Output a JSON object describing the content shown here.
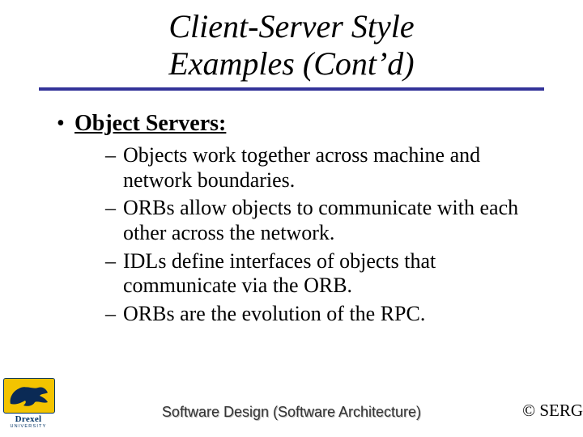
{
  "title": {
    "line1": "Client-Server Style",
    "line2": "Examples (Cont’d)"
  },
  "bullet": {
    "marker": "•",
    "text": "Object Servers:"
  },
  "sub": {
    "dash": "–",
    "items": [
      "Objects work together across machine and network boundaries.",
      "ORBs allow objects to communicate with each other across the network.",
      "IDLs define interfaces of objects that communicate via the ORB.",
      "ORBs are the evolution of the RPC."
    ]
  },
  "footer": {
    "logo_name": "Drexel",
    "logo_sub": "UNIVERSITY",
    "center": "Software Design (Software Architecture)",
    "right": "© SERG"
  },
  "colors": {
    "underline": "#333399",
    "logo_bg": "#f3c400",
    "logo_border": "#003366"
  }
}
